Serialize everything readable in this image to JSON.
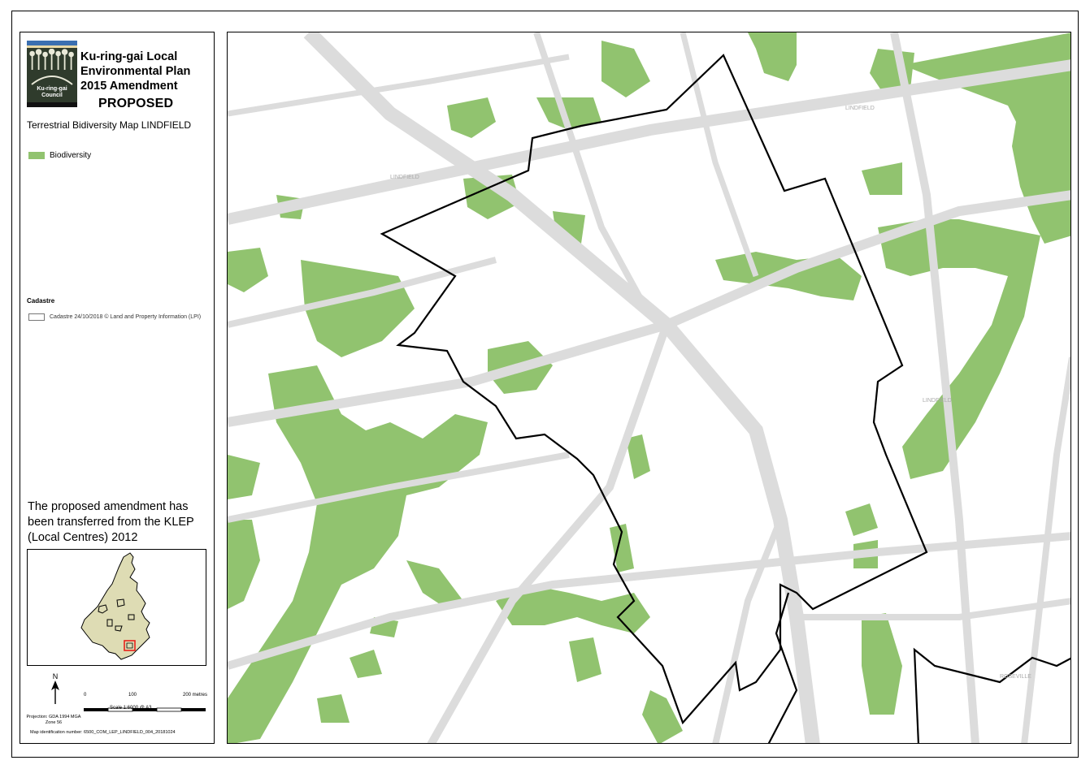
{
  "legend": {
    "title": "Ku-ring-gai Local Environmental Plan 2015 Amendment",
    "proposed": "PROPOSED",
    "subtitle": "Terrestrial Bidiversity Map LINDFIELD",
    "biodiversity_label": "Biodiversity",
    "biodiversity_color": "#91c36f",
    "cadastre_heading": "Cadastre",
    "cadastre_label": "Cadastre 24/10/2018 © Land and Property Information (LPI)",
    "logo_text": "Ku-ring-gai Council",
    "note": "The proposed amendment has been transferred from the KLEP (Local Centres) 2012"
  },
  "scale": {
    "north_label": "N",
    "ticks": [
      "0",
      "100",
      "200 metres"
    ],
    "scale_text": "Scale  1:6000  @ A3",
    "projection": "Projection: GDA 1994 MGA Zone 56",
    "map_id": "Map identification number:  6500_COM_LEP_LINDFIELD_004_20181024"
  },
  "map": {
    "labels": [
      "LINDFIELD",
      "LINDFIELD",
      "LINDFIELD",
      "ROSEVILLE"
    ],
    "boundary_color": "#000000",
    "street_color": "#dcdcdc",
    "inset_fill": "#dedcb4",
    "inset_marker_color": "#e8201a"
  }
}
